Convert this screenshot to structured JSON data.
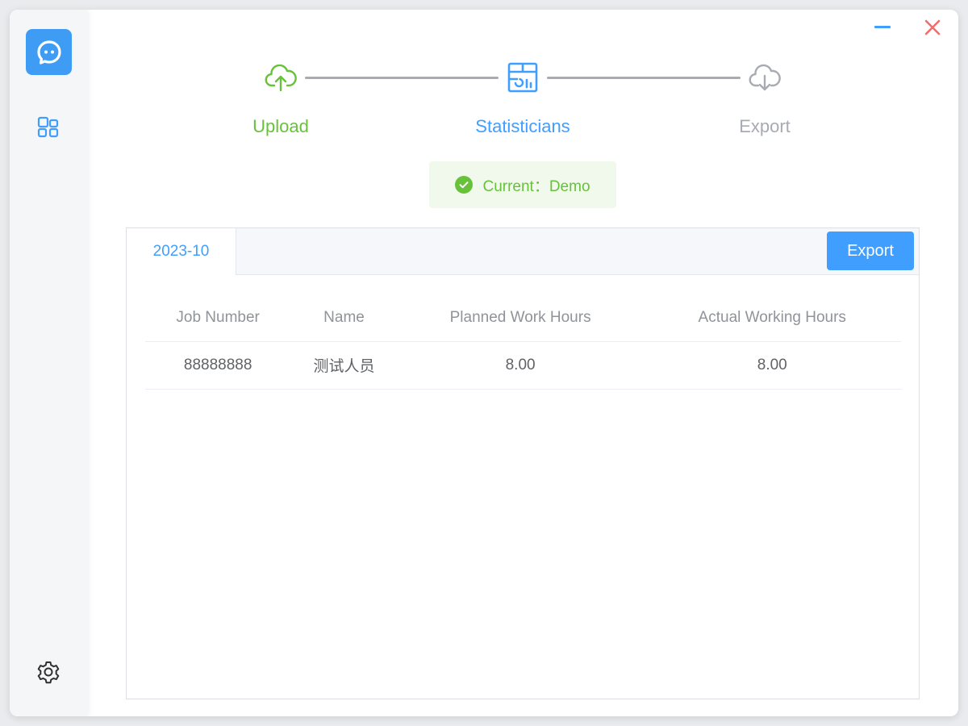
{
  "window": {
    "minimize_icon": "minimize-icon",
    "close_icon": "close-icon",
    "close_color": "#f56c6c",
    "minimize_color": "#409eff"
  },
  "sidebar": {
    "logo_icon": "chat-bubble-icon",
    "nav_icon": "apps-grid-icon",
    "settings_icon": "gear-icon"
  },
  "steps": [
    {
      "label": "Upload",
      "icon": "cloud-upload-icon",
      "state": "done",
      "color": "#67c23a"
    },
    {
      "label": "Statisticians",
      "icon": "statistics-table-icon",
      "state": "current",
      "color": "#409eff"
    },
    {
      "label": "Export",
      "icon": "cloud-download-icon",
      "state": "pending",
      "color": "#a8abb2"
    }
  ],
  "current": {
    "text": "Current：Demo",
    "icon": "check-circle-icon"
  },
  "tabs": {
    "active": "2023-10"
  },
  "export_button": "Export",
  "table": {
    "headers": [
      "Job Number",
      "Name",
      "Planned Work Hours",
      "Actual Working Hours"
    ],
    "rows": [
      [
        "88888888",
        "测试人员",
        "8.00",
        "8.00"
      ]
    ]
  },
  "colors": {
    "accent": "#409eff",
    "success": "#67c23a",
    "muted": "#a8abb2"
  }
}
